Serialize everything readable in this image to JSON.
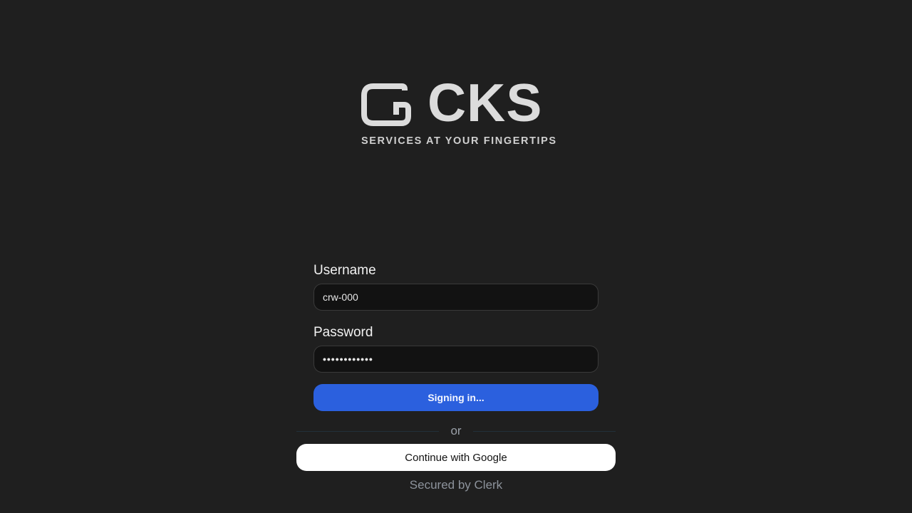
{
  "brand": {
    "wordmark": "CKS",
    "tagline": "SERVICES AT YOUR FINGERTIPS",
    "logo_color": "#dcdcdc"
  },
  "form": {
    "username_label": "Username",
    "username_value": "crw-000",
    "password_label": "Password",
    "password_value": "••••••••••••",
    "submit_label": "Signing in..."
  },
  "divider": {
    "text": "or"
  },
  "google_button": {
    "label": "Continue with Google"
  },
  "footer": {
    "secured_text": "Secured by Clerk"
  },
  "colors": {
    "background": "#1f1f1f",
    "primary": "#2b60de",
    "input_bg": "#121212"
  }
}
